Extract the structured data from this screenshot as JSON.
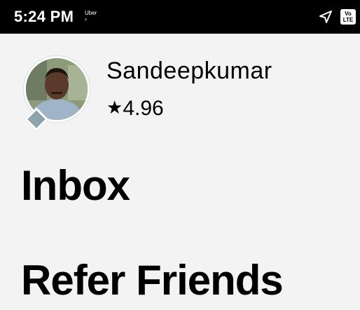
{
  "status_bar": {
    "time": "5:24 PM",
    "app_label": "Uber",
    "app_chevron": "›",
    "icons": [
      "navigation-arrow-icon",
      "volte-icon"
    ],
    "volte_top": "Vo",
    "volte_bottom": "LTE"
  },
  "profile": {
    "name": "Sandeepkumar",
    "rating_star": "★",
    "rating": "4.96",
    "avatar_badge_color": "#8da3ad"
  },
  "menu": {
    "items": [
      {
        "label": "Inbox"
      },
      {
        "label": "Refer Friends"
      }
    ]
  },
  "colors": {
    "background": "#f3f3f3",
    "status_bar": "#000000",
    "text": "#000000"
  }
}
